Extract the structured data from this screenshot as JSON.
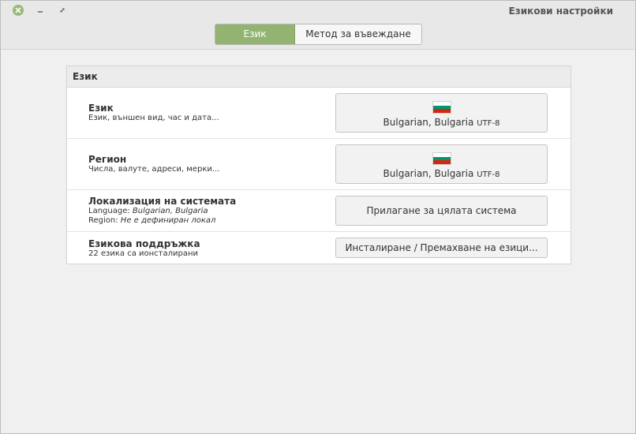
{
  "window": {
    "title": "Езикови настройки"
  },
  "tabs": [
    {
      "label": "Език",
      "active": true
    },
    {
      "label": "Метод за въвеждане",
      "active": false
    }
  ],
  "panel": {
    "header": "Език",
    "rows": [
      {
        "title": "Език",
        "subtitle": "Език, външен вид, час и дата...",
        "button": {
          "flag": "bulgarian-flag-icon",
          "language": "Bulgarian, Bulgaria",
          "encoding": "UTF-8"
        }
      },
      {
        "title": "Регион",
        "subtitle": "Числа, валуте, адреси, мерки...",
        "button": {
          "flag": "bulgarian-flag-icon",
          "language": "Bulgarian, Bulgaria",
          "encoding": "UTF-8"
        }
      },
      {
        "title": "Локализация на системата",
        "language_label": "Language:",
        "language_value": "Bulgarian, Bulgaria",
        "region_label": "Region:",
        "region_value": "Не е дефиниран локал",
        "button": {
          "label": "Прилагане за цялата система"
        }
      },
      {
        "title": "Езикова поддръжка",
        "subtitle": "22 езика са ионсталирани",
        "button": {
          "label": "Инсталиране / Премахване на езици..."
        }
      }
    ]
  },
  "colors": {
    "accent": "#93b470",
    "flag_white": "#ffffff",
    "flag_green": "#00966e",
    "flag_red": "#d62612"
  }
}
